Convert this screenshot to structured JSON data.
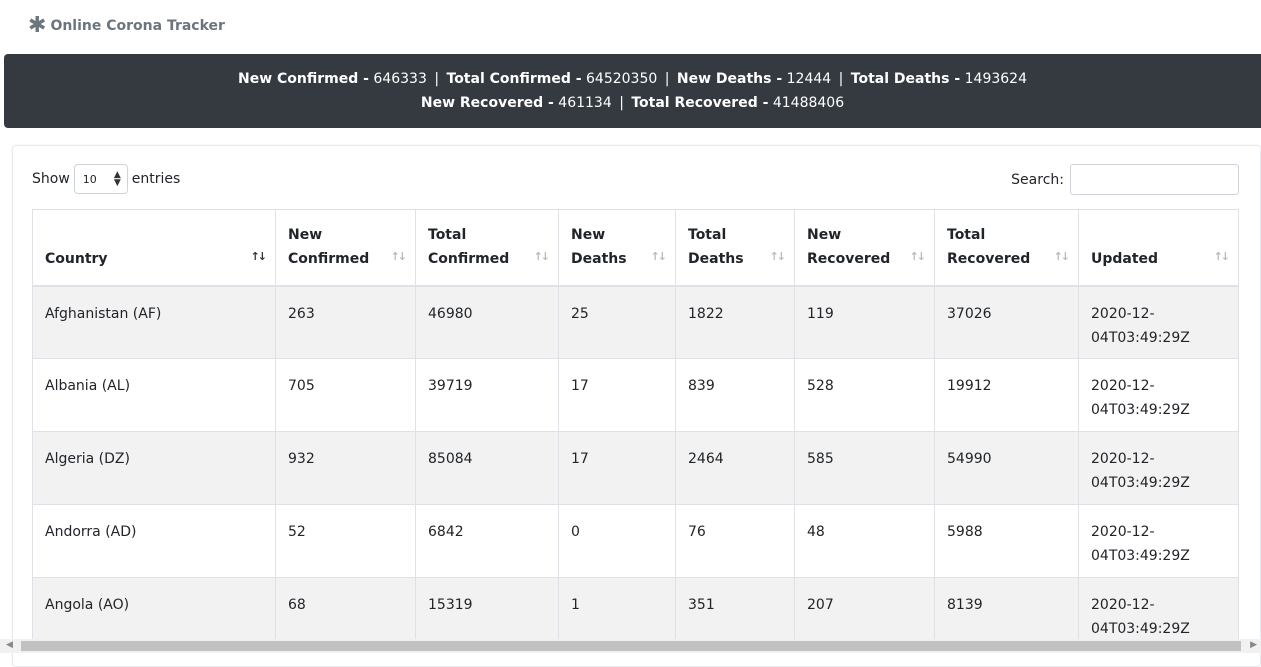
{
  "brand": {
    "icon": "asterisk-icon",
    "title": "Online Corona Tracker"
  },
  "summary": {
    "new_confirmed_label": "New Confirmed -",
    "new_confirmed": "646333",
    "total_confirmed_label": "Total Confirmed -",
    "total_confirmed": "64520350",
    "new_deaths_label": "New Deaths -",
    "new_deaths": "12444",
    "total_deaths_label": "Total Deaths -",
    "total_deaths": "1493624",
    "new_recovered_label": "New Recovered -",
    "new_recovered": "461134",
    "total_recovered_label": "Total Recovered -",
    "total_recovered": "41488406",
    "separator": "|"
  },
  "controls": {
    "show_label": "Show",
    "page_size": "10",
    "entries_label": "entries",
    "search_label": "Search:",
    "search_value": ""
  },
  "table": {
    "columns": [
      {
        "line1": "Country",
        "line2": ""
      },
      {
        "line1": "New",
        "line2": "Confirmed"
      },
      {
        "line1": "Total",
        "line2": "Confirmed"
      },
      {
        "line1": "New",
        "line2": "Deaths"
      },
      {
        "line1": "Total",
        "line2": "Deaths"
      },
      {
        "line1": "New",
        "line2": "Recovered"
      },
      {
        "line1": "Total",
        "line2": "Recovered"
      },
      {
        "line1": "Updated",
        "line2": ""
      }
    ],
    "sorted_column": "Country",
    "rows": [
      {
        "country": "Afghanistan (AF)",
        "new_confirmed": "263",
        "total_confirmed": "46980",
        "new_deaths": "25",
        "total_deaths": "1822",
        "new_recovered": "119",
        "total_recovered": "37026",
        "updated_date": "2020-12-",
        "updated_time": "04T03:49:29Z"
      },
      {
        "country": "Albania (AL)",
        "new_confirmed": "705",
        "total_confirmed": "39719",
        "new_deaths": "17",
        "total_deaths": "839",
        "new_recovered": "528",
        "total_recovered": "19912",
        "updated_date": "2020-12-",
        "updated_time": "04T03:49:29Z"
      },
      {
        "country": "Algeria (DZ)",
        "new_confirmed": "932",
        "total_confirmed": "85084",
        "new_deaths": "17",
        "total_deaths": "2464",
        "new_recovered": "585",
        "total_recovered": "54990",
        "updated_date": "2020-12-",
        "updated_time": "04T03:49:29Z"
      },
      {
        "country": "Andorra (AD)",
        "new_confirmed": "52",
        "total_confirmed": "6842",
        "new_deaths": "0",
        "total_deaths": "76",
        "new_recovered": "48",
        "total_recovered": "5988",
        "updated_date": "2020-12-",
        "updated_time": "04T03:49:29Z"
      },
      {
        "country": "Angola (AO)",
        "new_confirmed": "68",
        "total_confirmed": "15319",
        "new_deaths": "1",
        "total_deaths": "351",
        "new_recovered": "207",
        "total_recovered": "8139",
        "updated_date": "2020-12-",
        "updated_time": "04T03:49:29Z"
      }
    ]
  }
}
